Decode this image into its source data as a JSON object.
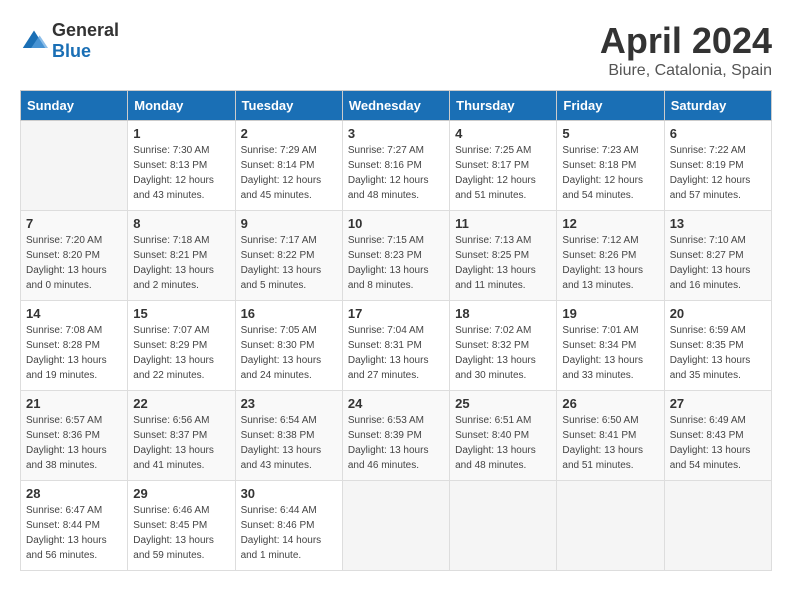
{
  "header": {
    "logo_general": "General",
    "logo_blue": "Blue",
    "month_title": "April 2024",
    "location": "Biure, Catalonia, Spain"
  },
  "weekdays": [
    "Sunday",
    "Monday",
    "Tuesday",
    "Wednesday",
    "Thursday",
    "Friday",
    "Saturday"
  ],
  "weeks": [
    [
      {
        "day": "",
        "sunrise": "",
        "sunset": "",
        "daylight": ""
      },
      {
        "day": "1",
        "sunrise": "Sunrise: 7:30 AM",
        "sunset": "Sunset: 8:13 PM",
        "daylight": "Daylight: 12 hours and 43 minutes."
      },
      {
        "day": "2",
        "sunrise": "Sunrise: 7:29 AM",
        "sunset": "Sunset: 8:14 PM",
        "daylight": "Daylight: 12 hours and 45 minutes."
      },
      {
        "day": "3",
        "sunrise": "Sunrise: 7:27 AM",
        "sunset": "Sunset: 8:16 PM",
        "daylight": "Daylight: 12 hours and 48 minutes."
      },
      {
        "day": "4",
        "sunrise": "Sunrise: 7:25 AM",
        "sunset": "Sunset: 8:17 PM",
        "daylight": "Daylight: 12 hours and 51 minutes."
      },
      {
        "day": "5",
        "sunrise": "Sunrise: 7:23 AM",
        "sunset": "Sunset: 8:18 PM",
        "daylight": "Daylight: 12 hours and 54 minutes."
      },
      {
        "day": "6",
        "sunrise": "Sunrise: 7:22 AM",
        "sunset": "Sunset: 8:19 PM",
        "daylight": "Daylight: 12 hours and 57 minutes."
      }
    ],
    [
      {
        "day": "7",
        "sunrise": "Sunrise: 7:20 AM",
        "sunset": "Sunset: 8:20 PM",
        "daylight": "Daylight: 13 hours and 0 minutes."
      },
      {
        "day": "8",
        "sunrise": "Sunrise: 7:18 AM",
        "sunset": "Sunset: 8:21 PM",
        "daylight": "Daylight: 13 hours and 2 minutes."
      },
      {
        "day": "9",
        "sunrise": "Sunrise: 7:17 AM",
        "sunset": "Sunset: 8:22 PM",
        "daylight": "Daylight: 13 hours and 5 minutes."
      },
      {
        "day": "10",
        "sunrise": "Sunrise: 7:15 AM",
        "sunset": "Sunset: 8:23 PM",
        "daylight": "Daylight: 13 hours and 8 minutes."
      },
      {
        "day": "11",
        "sunrise": "Sunrise: 7:13 AM",
        "sunset": "Sunset: 8:25 PM",
        "daylight": "Daylight: 13 hours and 11 minutes."
      },
      {
        "day": "12",
        "sunrise": "Sunrise: 7:12 AM",
        "sunset": "Sunset: 8:26 PM",
        "daylight": "Daylight: 13 hours and 13 minutes."
      },
      {
        "day": "13",
        "sunrise": "Sunrise: 7:10 AM",
        "sunset": "Sunset: 8:27 PM",
        "daylight": "Daylight: 13 hours and 16 minutes."
      }
    ],
    [
      {
        "day": "14",
        "sunrise": "Sunrise: 7:08 AM",
        "sunset": "Sunset: 8:28 PM",
        "daylight": "Daylight: 13 hours and 19 minutes."
      },
      {
        "day": "15",
        "sunrise": "Sunrise: 7:07 AM",
        "sunset": "Sunset: 8:29 PM",
        "daylight": "Daylight: 13 hours and 22 minutes."
      },
      {
        "day": "16",
        "sunrise": "Sunrise: 7:05 AM",
        "sunset": "Sunset: 8:30 PM",
        "daylight": "Daylight: 13 hours and 24 minutes."
      },
      {
        "day": "17",
        "sunrise": "Sunrise: 7:04 AM",
        "sunset": "Sunset: 8:31 PM",
        "daylight": "Daylight: 13 hours and 27 minutes."
      },
      {
        "day": "18",
        "sunrise": "Sunrise: 7:02 AM",
        "sunset": "Sunset: 8:32 PM",
        "daylight": "Daylight: 13 hours and 30 minutes."
      },
      {
        "day": "19",
        "sunrise": "Sunrise: 7:01 AM",
        "sunset": "Sunset: 8:34 PM",
        "daylight": "Daylight: 13 hours and 33 minutes."
      },
      {
        "day": "20",
        "sunrise": "Sunrise: 6:59 AM",
        "sunset": "Sunset: 8:35 PM",
        "daylight": "Daylight: 13 hours and 35 minutes."
      }
    ],
    [
      {
        "day": "21",
        "sunrise": "Sunrise: 6:57 AM",
        "sunset": "Sunset: 8:36 PM",
        "daylight": "Daylight: 13 hours and 38 minutes."
      },
      {
        "day": "22",
        "sunrise": "Sunrise: 6:56 AM",
        "sunset": "Sunset: 8:37 PM",
        "daylight": "Daylight: 13 hours and 41 minutes."
      },
      {
        "day": "23",
        "sunrise": "Sunrise: 6:54 AM",
        "sunset": "Sunset: 8:38 PM",
        "daylight": "Daylight: 13 hours and 43 minutes."
      },
      {
        "day": "24",
        "sunrise": "Sunrise: 6:53 AM",
        "sunset": "Sunset: 8:39 PM",
        "daylight": "Daylight: 13 hours and 46 minutes."
      },
      {
        "day": "25",
        "sunrise": "Sunrise: 6:51 AM",
        "sunset": "Sunset: 8:40 PM",
        "daylight": "Daylight: 13 hours and 48 minutes."
      },
      {
        "day": "26",
        "sunrise": "Sunrise: 6:50 AM",
        "sunset": "Sunset: 8:41 PM",
        "daylight": "Daylight: 13 hours and 51 minutes."
      },
      {
        "day": "27",
        "sunrise": "Sunrise: 6:49 AM",
        "sunset": "Sunset: 8:43 PM",
        "daylight": "Daylight: 13 hours and 54 minutes."
      }
    ],
    [
      {
        "day": "28",
        "sunrise": "Sunrise: 6:47 AM",
        "sunset": "Sunset: 8:44 PM",
        "daylight": "Daylight: 13 hours and 56 minutes."
      },
      {
        "day": "29",
        "sunrise": "Sunrise: 6:46 AM",
        "sunset": "Sunset: 8:45 PM",
        "daylight": "Daylight: 13 hours and 59 minutes."
      },
      {
        "day": "30",
        "sunrise": "Sunrise: 6:44 AM",
        "sunset": "Sunset: 8:46 PM",
        "daylight": "Daylight: 14 hours and 1 minute."
      },
      {
        "day": "",
        "sunrise": "",
        "sunset": "",
        "daylight": ""
      },
      {
        "day": "",
        "sunrise": "",
        "sunset": "",
        "daylight": ""
      },
      {
        "day": "",
        "sunrise": "",
        "sunset": "",
        "daylight": ""
      },
      {
        "day": "",
        "sunrise": "",
        "sunset": "",
        "daylight": ""
      }
    ]
  ]
}
